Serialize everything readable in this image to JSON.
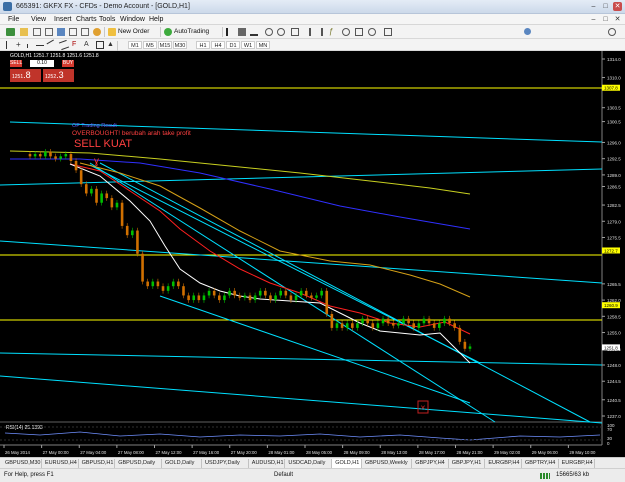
{
  "window": {
    "title": "665391: GKFX FX - CFDs - Demo Account - [GOLD,H1]",
    "buttons": [
      "–",
      "□",
      "✕"
    ]
  },
  "menu": [
    "File",
    "View",
    "Insert",
    "Charts",
    "Tools",
    "Window",
    "Help"
  ],
  "toolbar": {
    "new_order_label": "New Order",
    "autotrading_label": "AutoTrading",
    "timeframes": [
      "M1",
      "M5",
      "M15",
      "M30",
      "H1",
      "H4",
      "D1",
      "W1",
      "MN"
    ]
  },
  "chart": {
    "symbol_info": "GOLD,H1  1251.7 1251.8 1251.6 1251.8",
    "annotation_small": "OP Trading Result",
    "annotation_warning": "OVERBOUGHT! berubah arah take profit",
    "annotation_signal": "SELL KUAT",
    "rsi_label": "RSI(14) 25.1393",
    "colors": {
      "background": "#000000",
      "trendline": "#00ffff",
      "price_line": "#ffff00",
      "ma_fast": "#ffffff",
      "ma_red": "#ff2020",
      "ma_gold": "#d4a017",
      "ma_yellowgreen": "#c8d020",
      "ma_blue": "#3030ff",
      "bull_candle": "#00c000",
      "bear_candle": "#d07000"
    },
    "price_axis": [
      "1314.0",
      "1310.0",
      "1303.5",
      "1300.5",
      "1296.0",
      "1292.5",
      "1289.0",
      "1286.5",
      "1282.5",
      "1279.0",
      "1275.5",
      "1265.5",
      "1262.0",
      "1258.5",
      "1255.0",
      "1251.5",
      "1248.0",
      "1244.5",
      "1240.5",
      "1237.0"
    ],
    "price_labels_highlight": [
      "1307.8",
      "1272.7",
      "1260.9",
      "1251.8"
    ],
    "rsi_axis": [
      "100",
      "70",
      "30",
      "0"
    ],
    "time_axis": [
      "26 May 2014",
      "27 May 00:00",
      "27 May 04:00",
      "27 May 08:00",
      "27 May 12:00",
      "27 May 16:00",
      "27 May 20:00",
      "28 May 01:00",
      "28 May 05:00",
      "28 May 09:00",
      "28 May 13:00",
      "28 May 17:00",
      "28 May 21:00",
      "29 May 02:00",
      "29 May 06:00",
      "29 May 10:00"
    ]
  },
  "one_click": {
    "sell_label": "SELL",
    "buy_label": "BUY",
    "volume": "0.10",
    "sell_price_prefix": "1251",
    "sell_price_big": ".8",
    "buy_price_prefix": "1252",
    "buy_price_big": ".3"
  },
  "tabs": [
    "GBPUSD,M30",
    "EURUSD,H4",
    "GBPUSD,H1",
    "GBPUSD,Daily",
    "GOLD,Daily",
    "USDJPY,Daily",
    "AUDUSD,H1",
    "USDCAD,Daily",
    "GOLD,H1",
    "GBPUSD,Weekly",
    "GBPJPY,H4",
    "GBPJPY,H1",
    "EURGBP,H4",
    "GBPTRY,H4",
    "EURGBP,H4",
    "GBPAUD,H4",
    "GC"
  ],
  "active_tab": "GOLD,H1",
  "status": {
    "help": "For Help, press F1",
    "profile": "Default",
    "traffic": "15665/63 kb"
  }
}
